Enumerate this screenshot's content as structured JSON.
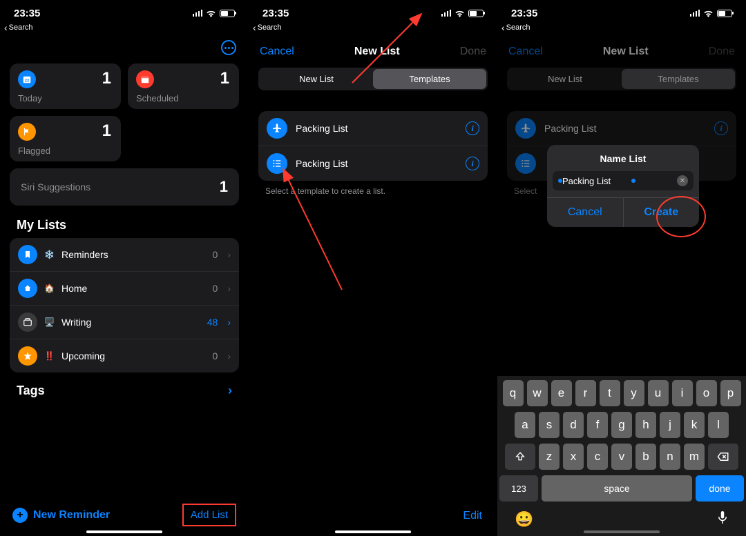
{
  "status": {
    "time": "23:35",
    "back_label": "Search"
  },
  "screen1": {
    "cards": {
      "today": {
        "label": "Today",
        "count": "1"
      },
      "scheduled": {
        "label": "Scheduled",
        "count": "1"
      },
      "flagged": {
        "label": "Flagged",
        "count": "1"
      }
    },
    "siri": {
      "label": "Siri Suggestions",
      "count": "1"
    },
    "mylists_title": "My Lists",
    "lists": {
      "reminders": {
        "emoji": "❄️",
        "label": "Reminders",
        "count": "0"
      },
      "home": {
        "emoji": "🏠",
        "label": "Home",
        "count": "0"
      },
      "writing": {
        "emoji": "🖥️",
        "label": "Writing",
        "count": "48"
      },
      "upcoming": {
        "emoji": "‼️",
        "label": "Upcoming",
        "count": "0"
      }
    },
    "tags_label": "Tags",
    "new_reminder_label": "New Reminder",
    "add_list_label": "Add List"
  },
  "screen2": {
    "nav": {
      "cancel": "Cancel",
      "title": "New List",
      "done": "Done"
    },
    "seg": {
      "newlist": "New List",
      "templates": "Templates"
    },
    "templates": {
      "a": {
        "label": "Packing List"
      },
      "b": {
        "label": "Packing List"
      }
    },
    "hint": "Select a template to create a list.",
    "edit_label": "Edit"
  },
  "screen3": {
    "nav": {
      "cancel": "Cancel",
      "title": "New List",
      "done": "Done"
    },
    "seg": {
      "newlist": "New List",
      "templates": "Templates"
    },
    "templates": {
      "a": {
        "label": "Packing List"
      }
    },
    "hint_prefix": "Select",
    "popup": {
      "title": "Name List",
      "input_value": "Packing List",
      "cancel": "Cancel",
      "create": "Create"
    },
    "keyboard": {
      "row1": [
        "q",
        "w",
        "e",
        "r",
        "t",
        "y",
        "u",
        "i",
        "o",
        "p"
      ],
      "row2": [
        "a",
        "s",
        "d",
        "f",
        "g",
        "h",
        "j",
        "k",
        "l"
      ],
      "row3": [
        "z",
        "x",
        "c",
        "v",
        "b",
        "n",
        "m"
      ],
      "numbers": "123",
      "space": "space",
      "done": "done"
    }
  }
}
